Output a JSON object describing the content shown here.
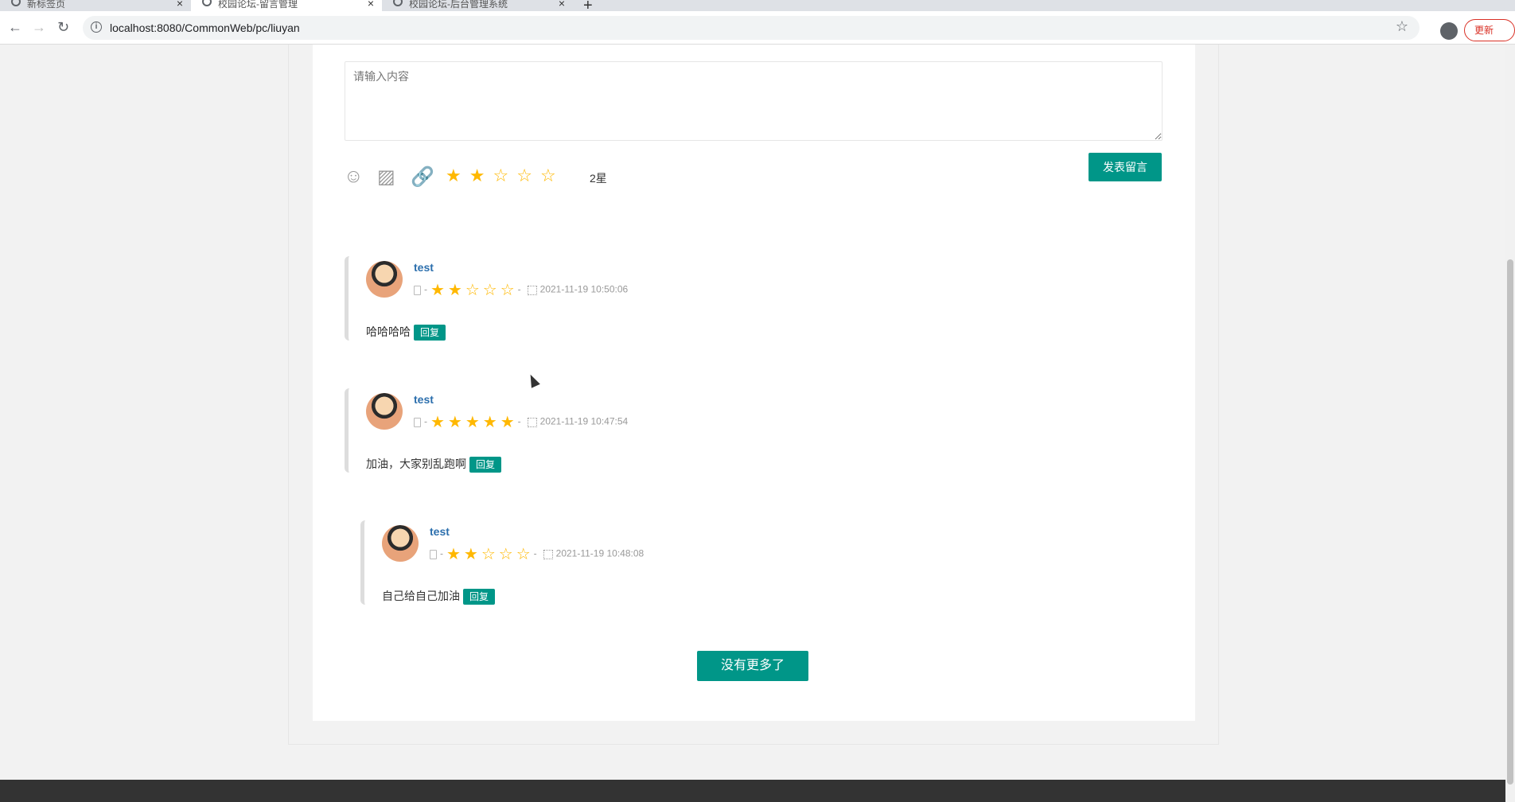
{
  "browser": {
    "tabs": [
      {
        "title": "新标签页",
        "active": false
      },
      {
        "title": "校园论坛-留言管理",
        "active": true
      },
      {
        "title": "校园论坛-后台管理系统",
        "active": false
      }
    ],
    "url": "localhost:8080/CommonWeb/pc/liuyan",
    "update_label": "更新"
  },
  "editor": {
    "placeholder": "请输入内容",
    "rating_value": 2,
    "rating_label": "2星",
    "submit_label": "发表留言"
  },
  "comments": [
    {
      "user": "test",
      "rating": 2,
      "time": "2021-11-19 10:50:06",
      "content": "哈哈哈哈",
      "reply_label": "回复"
    },
    {
      "user": "test",
      "rating": 5,
      "time": "2021-11-19 10:47:54",
      "content": "加油，大家别乱跑啊",
      "reply_label": "回复"
    },
    {
      "user": "test",
      "rating": 2,
      "time": "2021-11-19 10:48:08",
      "content": "自己给自己加油",
      "reply_label": "回复"
    }
  ],
  "more_label": "没有更多了",
  "colors": {
    "accent": "#009688",
    "star": "#ffb800",
    "username": "#2c6fad"
  }
}
